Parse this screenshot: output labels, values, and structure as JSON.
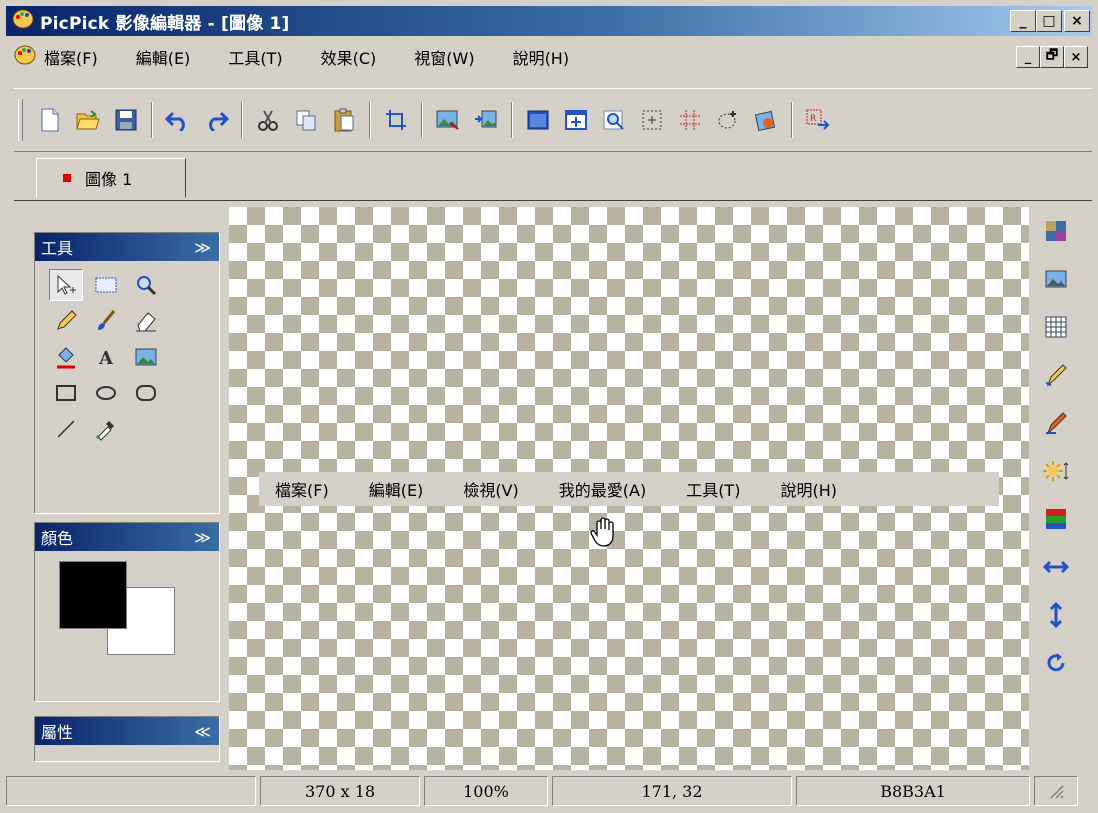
{
  "window": {
    "title": "PicPick 影像編輯器 - [圖像 1]",
    "caption_buttons": {
      "minimize": "_",
      "maximize": "□",
      "close": "×"
    }
  },
  "menubar": {
    "items": [
      "檔案(F)",
      "編輯(E)",
      "工具(T)",
      "效果(C)",
      "視窗(W)",
      "說明(H)"
    ],
    "mdi_buttons": {
      "minimize": "_",
      "restore": "🗗",
      "close": "×"
    }
  },
  "toolbar": {
    "buttons": [
      "new-icon",
      "open-icon",
      "save-icon",
      "undo-icon",
      "redo-icon",
      "cut-icon",
      "copy-icon",
      "paste-icon",
      "crop-icon",
      "image-icon",
      "image-arrange-icon",
      "fullscreen-icon",
      "add-window-icon",
      "zoom-icon",
      "region-icon",
      "grid-icon",
      "lasso-icon",
      "color-pick-icon",
      "capture-icon"
    ]
  },
  "tabs": [
    {
      "label": "圖像 1",
      "dot_color": "#e00000"
    }
  ],
  "panels": {
    "tools": {
      "title": "工具",
      "toggle": "≫"
    },
    "colors": {
      "title": "顏色",
      "toggle": "≫",
      "foreground": "#000000",
      "background": "#ffffff"
    },
    "properties": {
      "title": "屬性",
      "toggle": "≪"
    }
  },
  "canvas": {
    "captured_menu": [
      "檔案(F)",
      "編輯(E)",
      "檢視(V)",
      "我的最愛(A)",
      "工具(T)",
      "說明(H)"
    ],
    "checker_color": "#b8b3a1"
  },
  "statusbar": {
    "blank": "",
    "size": "370 x 18",
    "zoom": "100%",
    "position": "171, 32",
    "color": "B8B3A1"
  }
}
